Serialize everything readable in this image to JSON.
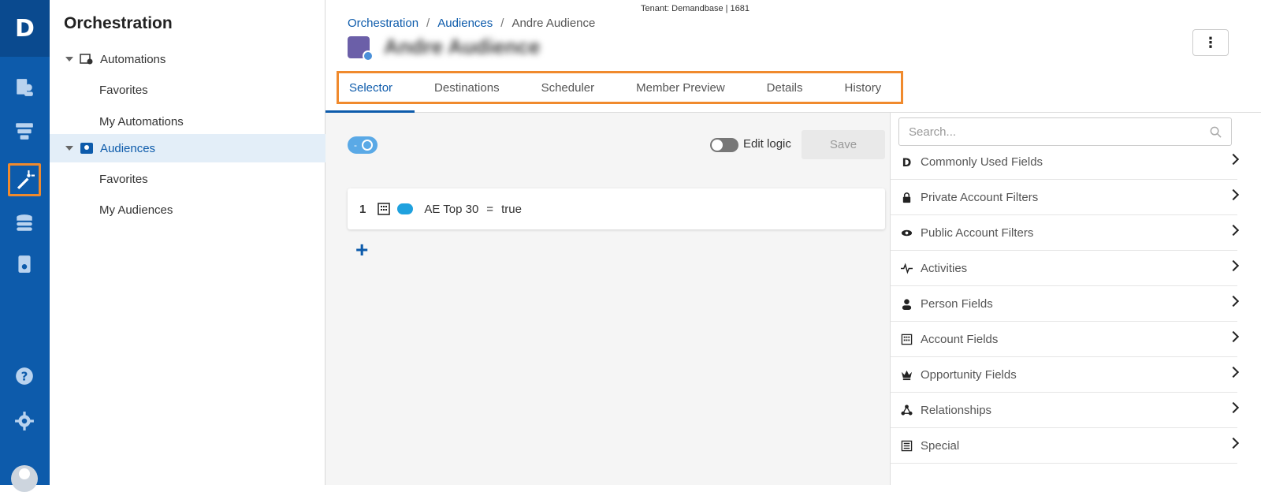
{
  "rail": {
    "logo": "D"
  },
  "nav": {
    "title": "Orchestration",
    "items": [
      {
        "label": "Automations"
      },
      {
        "label": "Favorites"
      },
      {
        "label": "My Automations"
      },
      {
        "label": "Audiences"
      },
      {
        "label": "Favorites"
      },
      {
        "label": "My Audiences"
      }
    ]
  },
  "header": {
    "tenant": "Tenant: Demandbase | 1681",
    "breadcrumbs": [
      "Orchestration",
      "Audiences",
      "Andre Audience"
    ],
    "separator": "/",
    "audience_name": "Andre Audience",
    "menu_glyph": "⋮"
  },
  "tabs": [
    "Selector",
    "Destinations",
    "Scheduler",
    "Member Preview",
    "Details",
    "History"
  ],
  "selector": {
    "toggle_label": "-",
    "edit_logic_label": "Edit logic",
    "save_label": "Save",
    "rule": {
      "number": "1",
      "field": "AE Top 30",
      "operator": "=",
      "value": "true"
    },
    "add_glyph": "+"
  },
  "fields_panel": {
    "search_placeholder": "Search...",
    "items": [
      {
        "label": "Commonly Used Fields",
        "icon": "demandbase-d-icon"
      },
      {
        "label": "Private Account Filters",
        "icon": "lock-icon"
      },
      {
        "label": "Public Account Filters",
        "icon": "eye-icon"
      },
      {
        "label": "Activities",
        "icon": "pulse-icon"
      },
      {
        "label": "Person Fields",
        "icon": "person-icon"
      },
      {
        "label": "Account Fields",
        "icon": "building-icon"
      },
      {
        "label": "Opportunity Fields",
        "icon": "crown-icon"
      },
      {
        "label": "Relationships",
        "icon": "network-icon"
      },
      {
        "label": "Special",
        "icon": "list-icon"
      }
    ]
  },
  "colors": {
    "rail": "#0d5bab",
    "accent": "#0d5bab",
    "highlight": "#f08a2d"
  }
}
